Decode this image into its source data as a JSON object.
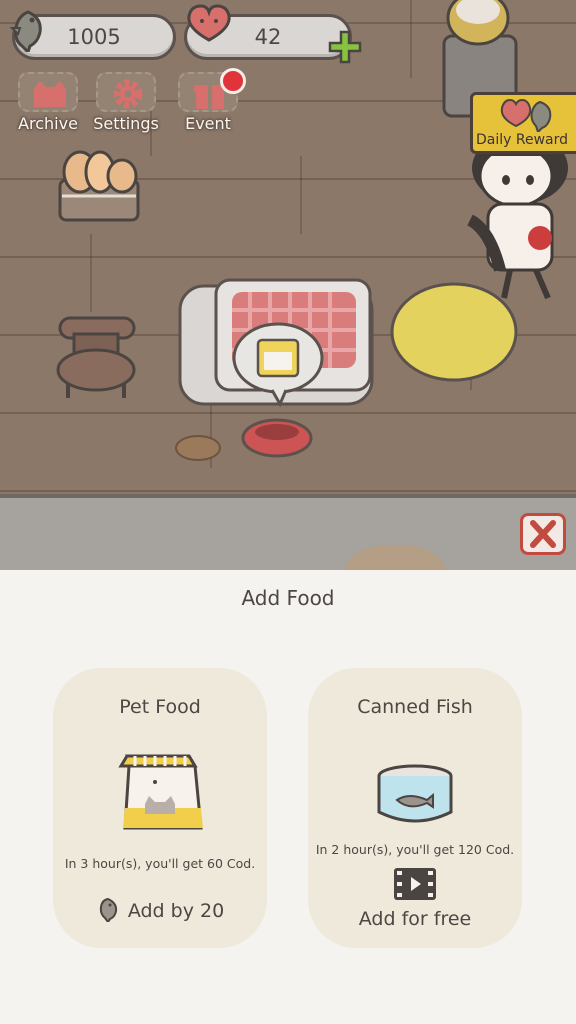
{
  "hud": {
    "fish_count": "1005",
    "heart_count": "42",
    "fish_icon": "fish-icon",
    "heart_icon": "heart-icon",
    "plus_icon": "plus-icon"
  },
  "menu": {
    "archive_label": "Archive",
    "settings_label": "Settings",
    "event_label": "Event",
    "event_has_notification": true
  },
  "daily_reward": {
    "label": "Daily Reward"
  },
  "sheet": {
    "title": "Add Food",
    "items": [
      {
        "name": "Pet Food",
        "description": "In 3 hour(s), you'll get 60 Cod.",
        "action_label": "Add by 20",
        "action_icon": "fish-icon",
        "image": "pet-food-bag"
      },
      {
        "name": "Canned Fish",
        "description": "In 2 hour(s), you'll get 120 Cod.",
        "action_label": "Add for free",
        "action_icon": "video-icon",
        "image": "canned-fish"
      }
    ]
  },
  "colors": {
    "accent_green": "#86c341",
    "close_red": "#c24b40",
    "reward_yellow": "#e6c23a"
  }
}
